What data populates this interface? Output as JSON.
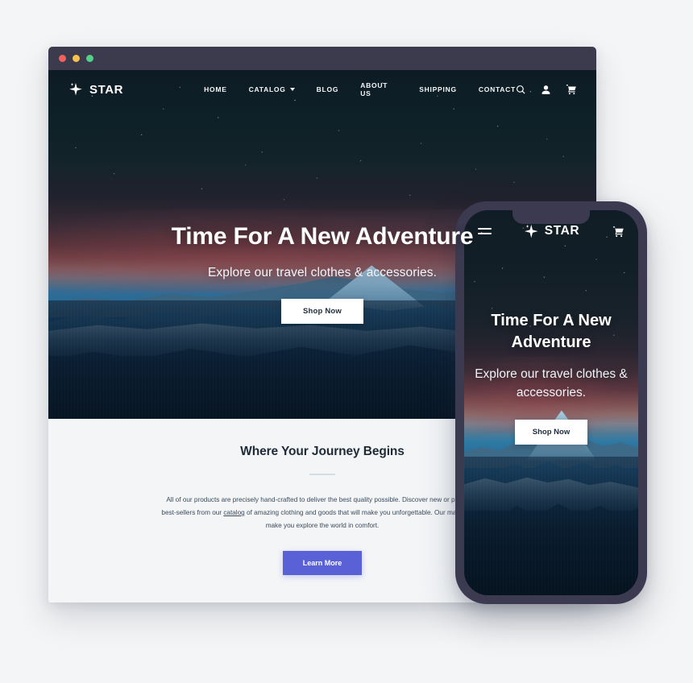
{
  "window": {
    "traffic_lights": [
      {
        "name": "close",
        "color": "#f2615c"
      },
      {
        "name": "minimize",
        "color": "#f6c24f"
      },
      {
        "name": "maximize",
        "color": "#52d08a"
      }
    ]
  },
  "desktop": {
    "brand": {
      "name": "STAR",
      "icon": "sparkle-star-icon"
    },
    "nav": [
      {
        "label": "HOME",
        "has_caret": false
      },
      {
        "label": "CATALOG",
        "has_caret": true
      },
      {
        "label": "BLOG",
        "has_caret": false
      },
      {
        "label": "ABOUT US",
        "has_caret": false
      },
      {
        "label": "SHIPPING",
        "has_caret": false
      },
      {
        "label": "CONTACT",
        "has_caret": false
      }
    ],
    "icons": [
      "search-icon",
      "account-icon",
      "cart-icon"
    ],
    "hero": {
      "title": "Time For A New Adventure",
      "subtitle": "Explore our travel clothes & accessories.",
      "cta": "Shop Now"
    },
    "about": {
      "title": "Where Your Journey Begins",
      "body_part_1": "All of our products are precisely hand-crafted to deliver the best quality possible. Discover new or purchase best-sellers from our ",
      "body_link": "catalog",
      "body_part_2": " of amazing clothing and goods that will make you unforgettable. Our main goal to make you explore the world in comfort.",
      "cta": "Learn More"
    }
  },
  "mobile": {
    "brand": {
      "name": "STAR",
      "icon": "sparkle-star-icon"
    },
    "menu_icon": "hamburger-menu-icon",
    "cart_icon": "cart-icon",
    "hero": {
      "title": "Time For A New Adventure",
      "subtitle": "Explore our travel clothes & accessories.",
      "cta": "Shop Now"
    }
  },
  "colors": {
    "page_background": "#f4f5f6",
    "titlebar": "#3c3a4d",
    "phone_frame": "#3c3a50",
    "accent_indigo": "#5a61d6",
    "section_background": "#f3f5f7",
    "heading_dark": "#1f2a37"
  }
}
